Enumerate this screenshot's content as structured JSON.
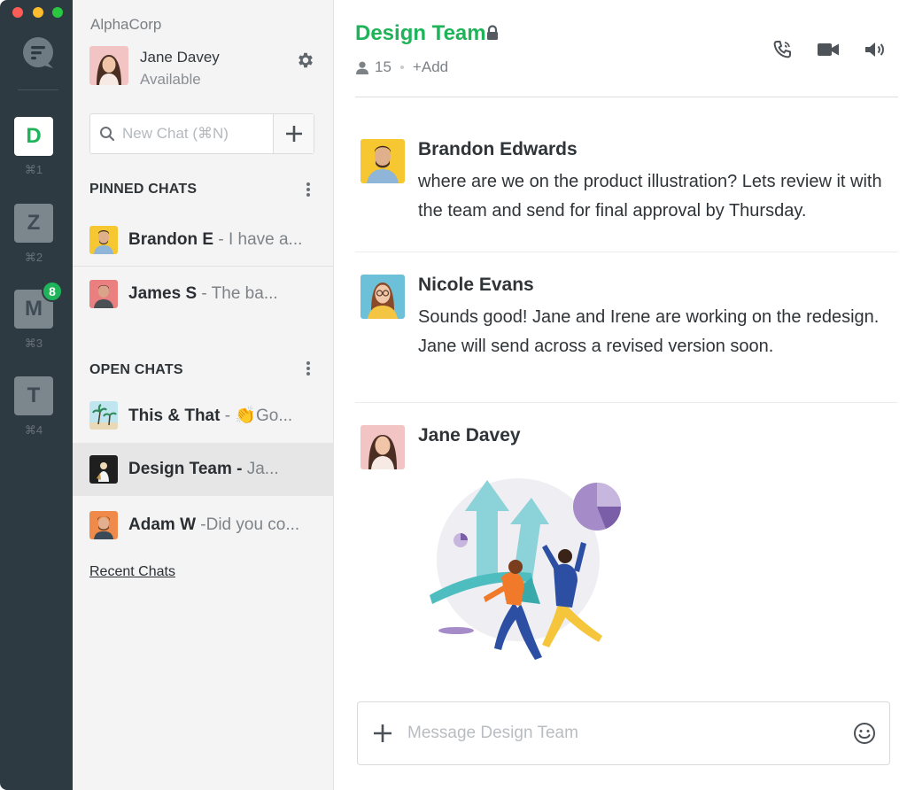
{
  "workspace": {
    "org_name": "AlphaCorp",
    "current_user": {
      "name": "Jane Davey",
      "status": "Available"
    },
    "new_chat_placeholder": "New Chat (⌘N)"
  },
  "rail": {
    "workspaces": [
      {
        "letter": "D",
        "shortcut": "⌘1",
        "active": true
      },
      {
        "letter": "Z",
        "shortcut": "⌘2",
        "active": false
      },
      {
        "letter": "M",
        "shortcut": "⌘3",
        "active": false,
        "badge": "8"
      },
      {
        "letter": "T",
        "shortcut": "⌘4",
        "active": false
      }
    ]
  },
  "sidebar": {
    "pinned_title": "PINNED CHATS",
    "pinned": [
      {
        "name": "Brandon E",
        "preview": " - I have a..."
      },
      {
        "name": "James S",
        "preview": "   - The ba..."
      }
    ],
    "open_title": "OPEN CHATS",
    "open": [
      {
        "name": "This & That",
        "preview": " - 👏Go..."
      },
      {
        "name": "Design Team - ",
        "preview": "Ja...",
        "selected": true
      },
      {
        "name": "Adam W",
        "preview": " -Did you co..."
      }
    ],
    "recent_link": "Recent Chats"
  },
  "room": {
    "title": "Design Team",
    "member_count": "15",
    "add_label": "+Add",
    "composer_placeholder": "Message Design Team"
  },
  "messages": [
    {
      "author": "Brandon Edwards",
      "text": "where are we on the product illustration? Lets review it with the team and send for final approval by Thursday."
    },
    {
      "author": "Nicole Evans",
      "text": "Sounds good! Jane and Irene are working on the redesign. Jane will send across a revised version soon."
    },
    {
      "author": "Jane Davey",
      "text": ""
    }
  ],
  "icons": {
    "app_logo": "chat-bubble-icon",
    "settings": "gear-icon",
    "search": "search-icon",
    "lock": "lock-icon",
    "members": "person-icon",
    "call": "phone-icon",
    "video": "video-camera-icon",
    "audio": "speaker-icon",
    "attach": "plus-icon",
    "emoji": "smiley-icon"
  },
  "colors": {
    "accent_green": "#1fb35a",
    "rail_bg": "#2e3a42",
    "sidebar_bg": "#f4f4f4",
    "selected_row": "#e6e6e6"
  }
}
